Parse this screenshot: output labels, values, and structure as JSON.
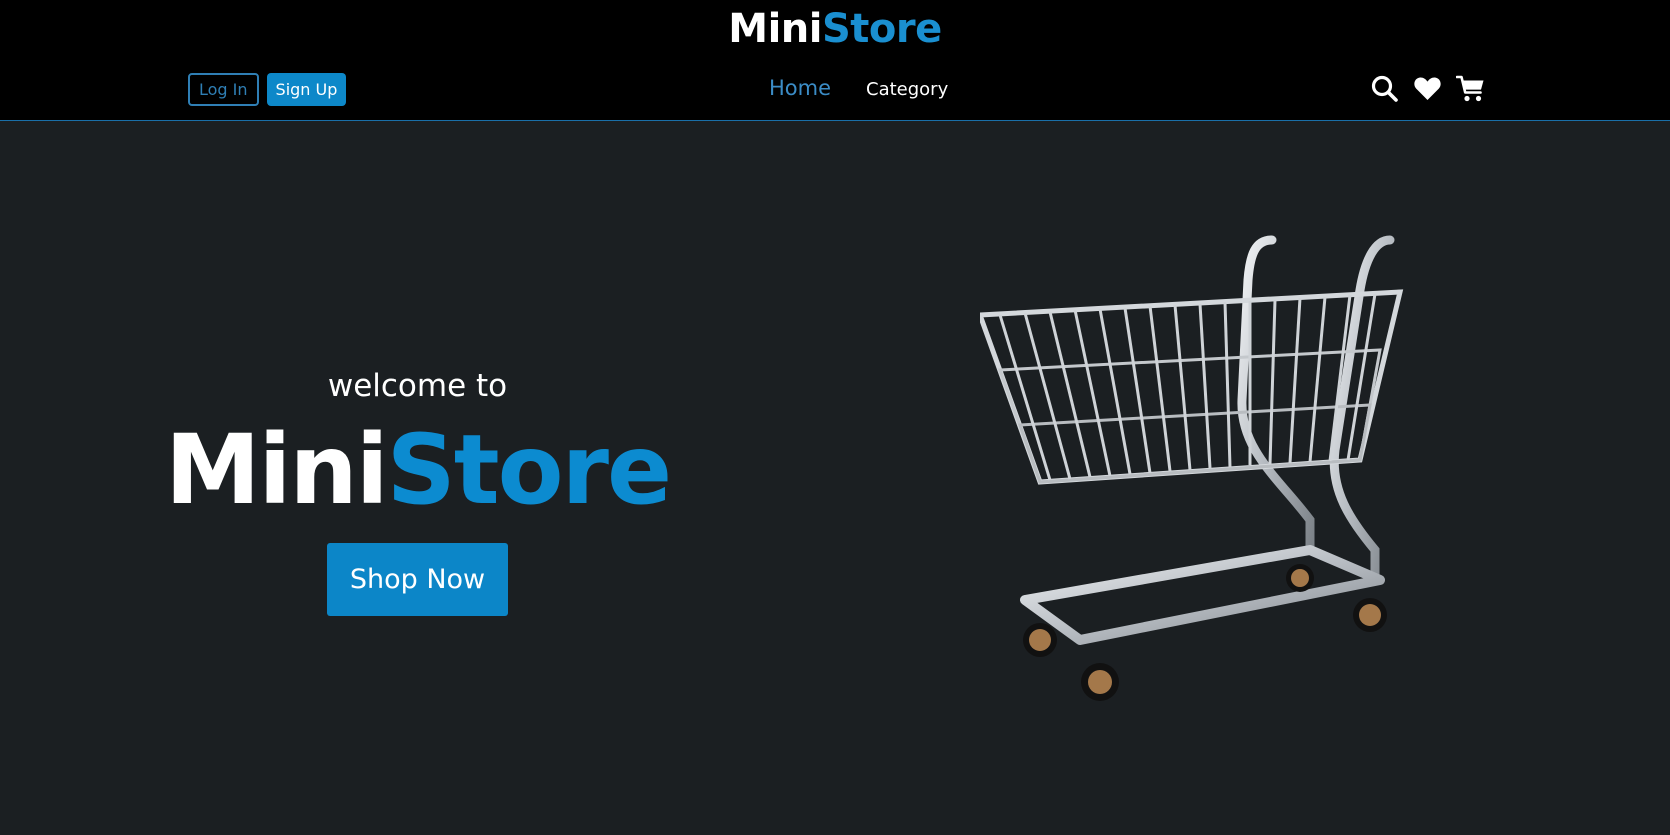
{
  "brand": {
    "part1": "Mini",
    "part2": "Store"
  },
  "auth": {
    "login_label": "Log In",
    "signup_label": "Sign Up"
  },
  "nav": {
    "home_label": "Home",
    "category_label": "Category"
  },
  "icons": {
    "search": "search-icon",
    "wishlist": "heart-icon",
    "cart": "cart-icon"
  },
  "hero": {
    "welcome": "welcome to",
    "brand_part1": "Mini",
    "brand_part2": "Store",
    "cta_label": "Shop Now",
    "image": "shopping-cart-image"
  },
  "colors": {
    "accent": "#0c8bd0",
    "header_bg": "#000000",
    "page_bg": "#1b1f22"
  }
}
